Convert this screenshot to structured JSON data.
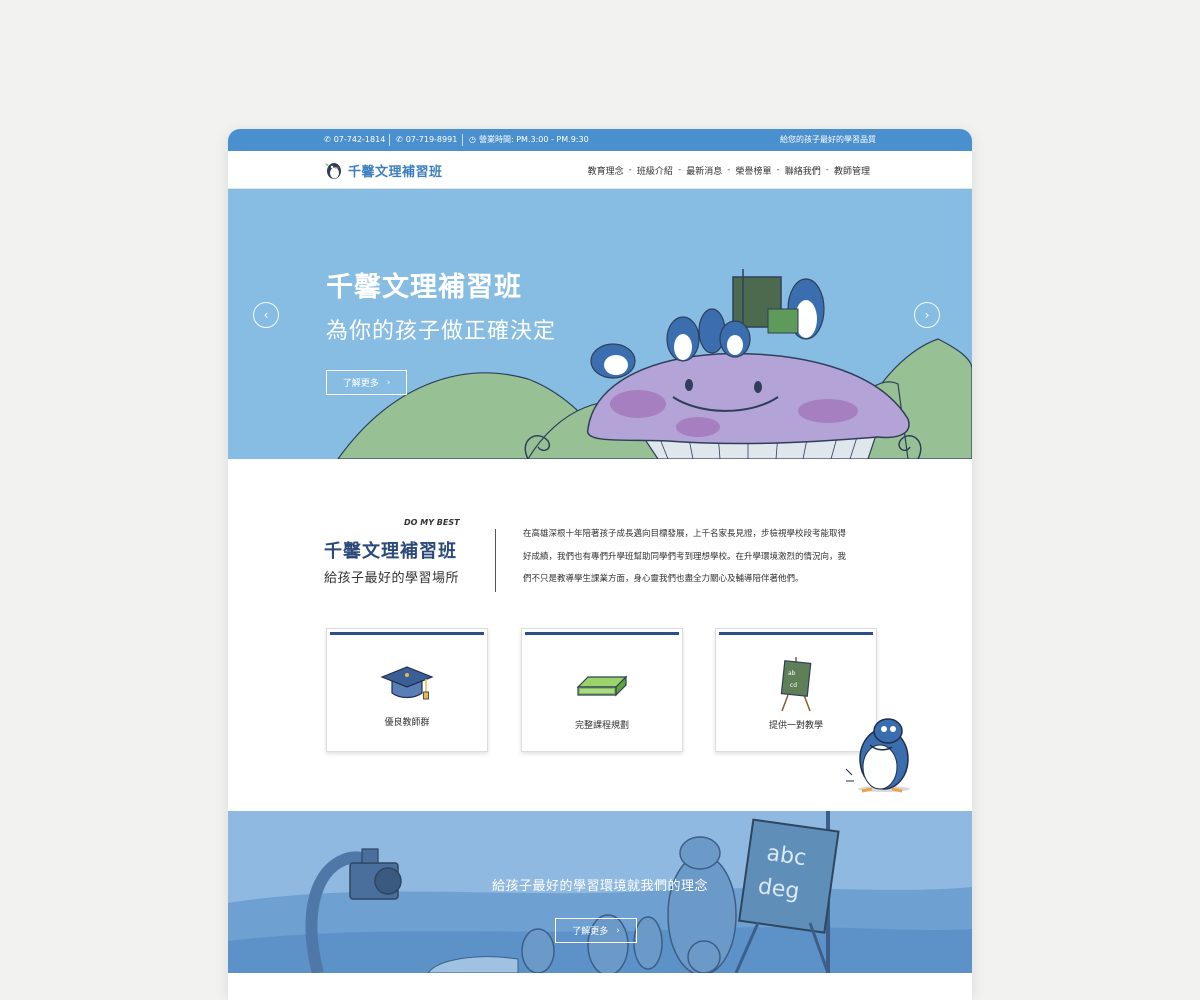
{
  "topbar": {
    "phone1": "07-742-1814",
    "phone2": "07-719-8991",
    "hours": "營業時間: PM.3:00 - PM.9:30",
    "slogan": "給您的孩子最好的學習品質"
  },
  "header": {
    "logo_text": "千馨文理補習班",
    "nav": [
      "教育理念",
      "班級介紹",
      "最新消息",
      "榮譽榜單",
      "聯絡我們",
      "教師管理"
    ],
    "nav_separator": "-"
  },
  "hero": {
    "title": "千馨文理補習班",
    "subtitle": "為你的孩子做正確決定",
    "button_label": "了解更多",
    "prev_icon": "chevron-left-icon",
    "next_icon": "chevron-right-icon"
  },
  "intro": {
    "tag": "DO MY BEST",
    "title": "千馨文理補習班",
    "subtitle": "給孩子最好的學習場所",
    "description": [
      "在高雄深根十年陪著孩子成長邁向目標發展，上千名家長見證，步檢視學校段考能取得",
      "好成績，我們也有專們升學班幫助同學們考到理想學校。在升學環境激烈的情況向，我",
      "們不只是教導學生課業方面，身心靈我們也盡全力關心及輔導陪伴著他們。"
    ]
  },
  "features": [
    {
      "label": "優良教師群",
      "icon": "graduation-cap-icon"
    },
    {
      "label": "完整課程規劃",
      "icon": "book-icon"
    },
    {
      "label": "提供一對教學",
      "icon": "chalkboard-icon"
    }
  ],
  "banner": {
    "text": "給孩子最好的學習環境就我們的理念",
    "button_label": "了解更多"
  },
  "colors": {
    "topbar": "#4a90cf",
    "hero_bg": "#87bde3",
    "card_accent": "#2c4f86",
    "banner_bg": "#8fb9e0",
    "logo": "#3c7fc0"
  }
}
